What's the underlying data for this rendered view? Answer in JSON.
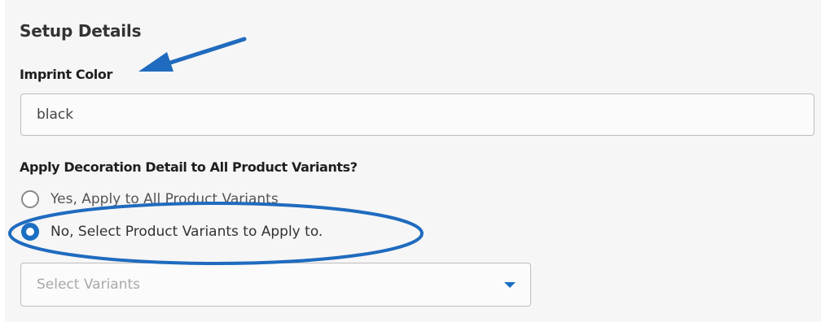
{
  "section": {
    "title": "Setup Details"
  },
  "imprint": {
    "label": "Imprint Color",
    "value": "black"
  },
  "apply": {
    "label": "Apply Decoration Detail to All Product Variants?",
    "options": [
      {
        "label": "Yes, Apply to All Product Variants",
        "selected": false
      },
      {
        "label": "No, Select Product Variants to Apply to.",
        "selected": true
      }
    ]
  },
  "variants": {
    "placeholder": "Select Variants",
    "icon": "caret-down-icon"
  },
  "colors": {
    "accent": "#1b6fc2",
    "annotation": "#1f6bbf",
    "panel_bg": "#f6f6f6"
  }
}
